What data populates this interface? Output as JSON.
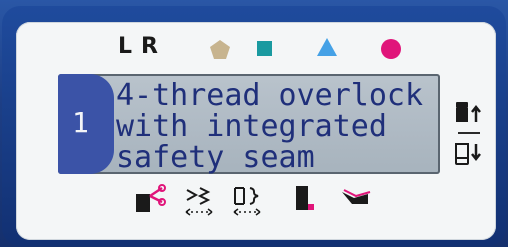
{
  "indicators": {
    "left_label": "L",
    "right_label": "R",
    "shapes": [
      {
        "name": "pentagon",
        "color": "#c7b48f"
      },
      {
        "name": "square",
        "color": "#1a9aa0"
      },
      {
        "name": "triangle",
        "color": "#45a1e6"
      },
      {
        "name": "circle",
        "color": "#e0157a"
      }
    ]
  },
  "lcd": {
    "program_number": "1",
    "lines": [
      "4-thread overlock",
      "with integrated",
      "safety seam"
    ]
  },
  "side_controls": {
    "up_icon": "thread-up-icon",
    "down_icon": "thread-down-icon"
  },
  "bottom_icons": [
    "scissors-icon",
    "stitch-width-icon",
    "stitch-length-icon",
    "presser-foot-icon",
    "needle-plate-icon"
  ],
  "colors": {
    "device_blue": "#1d3f86",
    "lcd_tab_blue": "#3b53a7",
    "lcd_text": "#1f2f7a",
    "accent_magenta": "#e0157a"
  }
}
